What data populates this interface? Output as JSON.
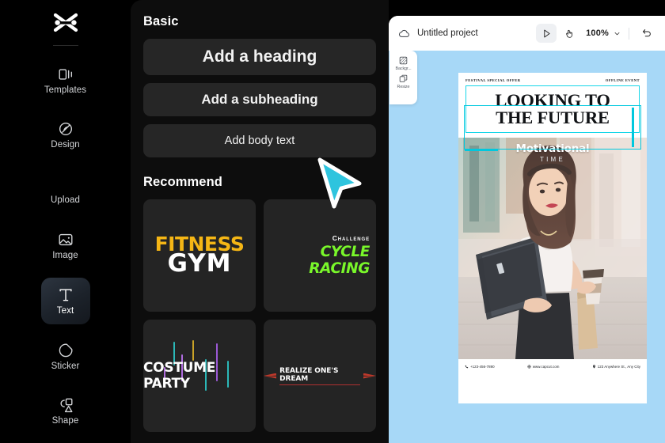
{
  "app": {
    "brand": "capcut-logo"
  },
  "sidebar": {
    "items": [
      {
        "label": "Templates",
        "icon": "templates-icon",
        "active": false
      },
      {
        "label": "Design",
        "icon": "design-icon",
        "active": false
      },
      {
        "label": "Upload",
        "icon": "upload-icon",
        "active": false
      },
      {
        "label": "Image",
        "icon": "image-icon",
        "active": false
      },
      {
        "label": "Text",
        "icon": "text-icon",
        "active": true
      },
      {
        "label": "Sticker",
        "icon": "sticker-icon",
        "active": false
      },
      {
        "label": "Shape",
        "icon": "shape-icon",
        "active": false
      }
    ]
  },
  "panel": {
    "basic_title": "Basic",
    "buttons": [
      {
        "label": "Add a heading"
      },
      {
        "label": "Add a subheading"
      },
      {
        "label": "Add body text"
      }
    ],
    "recommend_title": "Recommend",
    "cards": [
      {
        "name": "fitness-gym",
        "line1": "FITNESS",
        "line2": "GYM",
        "color1": "#F5B615",
        "color2": "#FFFFFF"
      },
      {
        "name": "cycle-racing",
        "line1": "Challenge",
        "line2": "CYCLE RACING",
        "color1": "#FFFFFF",
        "color2": "#79F72A"
      },
      {
        "name": "costume-party",
        "line1": "",
        "line2": "COSTUME PARTY",
        "color1": "#FFFFFF",
        "color2": "#FFFFFF"
      },
      {
        "name": "realize-dream",
        "line1": "",
        "line2": "REALIZE ONE'S DREAM",
        "color1": "#FFFFFF",
        "color2": "#C0392B"
      }
    ]
  },
  "editor": {
    "cloud_icon": "cloud-icon",
    "project_name": "Untitled project",
    "tools": [
      {
        "name": "select-tool",
        "icon": "cursor-icon",
        "selected": true
      },
      {
        "name": "hand-tool",
        "icon": "hand-icon",
        "selected": false
      }
    ],
    "zoom_level": "100%",
    "zoom_chevron": "chevron-down-icon",
    "undo_icon": "undo-icon",
    "mini_toolbar": [
      {
        "label": "Backgr...",
        "icon": "background-icon"
      },
      {
        "label": "Resize",
        "icon": "resize-icon"
      }
    ],
    "canvas_bg": "#A7D8F7",
    "accent": "#00C8DE"
  },
  "poster": {
    "header_left": "FESTIVAL SPECIAL OFFER",
    "header_right": "OFFLINE EVENT",
    "title_line1": "LOOKING TO",
    "title_line2": "THE FUTURE",
    "photo_caption": "Motivational",
    "photo_subcaption": "TIME",
    "footer": [
      {
        "icon": "phone-icon",
        "text": "+123-456-7890"
      },
      {
        "icon": "globe-icon",
        "text": "www.capcut.com"
      },
      {
        "icon": "location-icon",
        "text": "123 Anywhere St., Any City"
      }
    ]
  },
  "cursor": {
    "name": "mouse-pointer",
    "color": "#2EC4DE"
  }
}
